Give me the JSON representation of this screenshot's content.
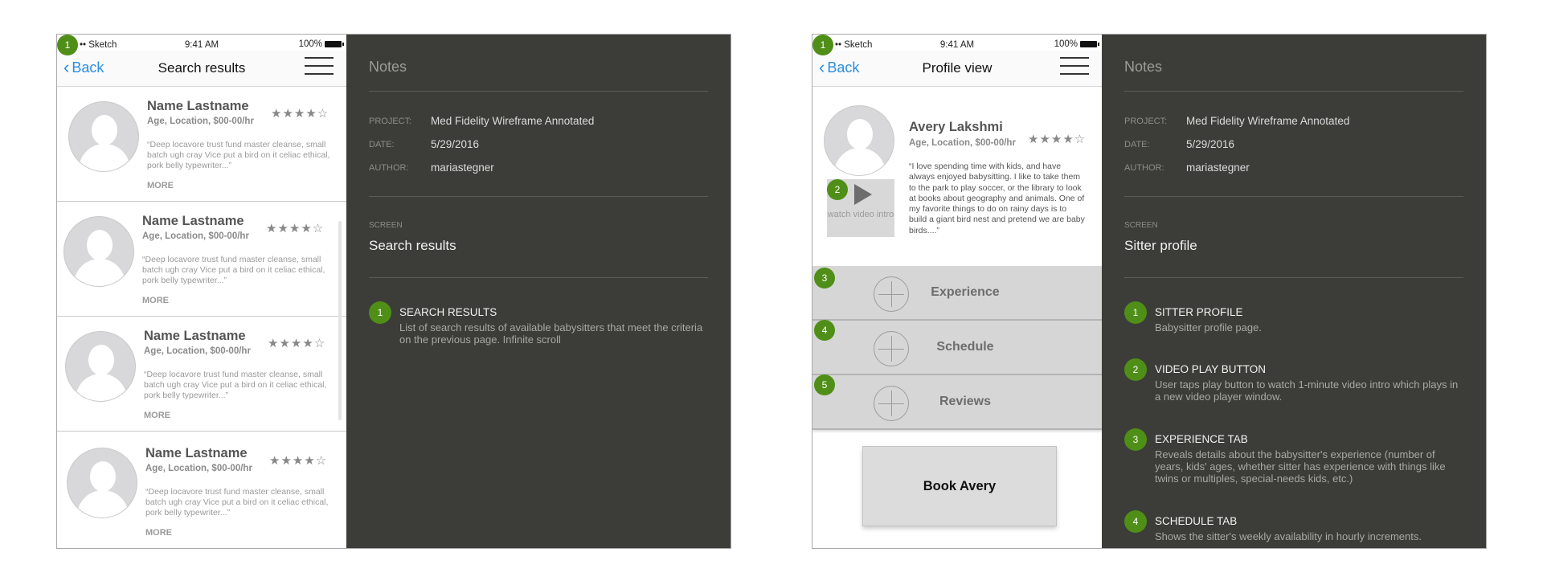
{
  "status_bar": {
    "carrier": "•• Sketch",
    "time": "9:41 AM",
    "battery": "100%"
  },
  "colors": {
    "badge": "#4f8f18",
    "notes_bg": "#3c3d38",
    "link": "#2a8de0"
  },
  "left": {
    "nav": {
      "back": "Back",
      "title": "Search results"
    },
    "badge": "1",
    "results": [
      {
        "name": "Name Lastname",
        "meta": "Age, Location, $00-00/hr",
        "stars": "★★★★☆",
        "quote": "“Deep locavore trust fund master cleanse, small batch ugh cray Vice put a bird on it celiac ethical, pork belly typewriter...”",
        "more": "MORE"
      },
      {
        "name": "Name Lastname",
        "meta": "Age, Location, $00-00/hr",
        "stars": "★★★★☆",
        "quote": "“Deep locavore trust fund master cleanse, small batch ugh cray Vice put a bird on it celiac ethical, pork belly typewriter...”",
        "more": "MORE"
      },
      {
        "name": "Name Lastname",
        "meta": "Age, Location, $00-00/hr",
        "stars": "★★★★☆",
        "quote": "“Deep locavore trust fund master cleanse, small batch ugh cray Vice put a bird on it celiac ethical, pork belly typewriter...”",
        "more": "MORE"
      },
      {
        "name": "Name Lastname",
        "meta": "Age, Location, $00-00/hr",
        "stars": "★★★★☆",
        "quote": "“Deep locavore trust fund master cleanse, small batch ugh cray Vice put a bird on it celiac ethical, pork belly typewriter...”",
        "more": "MORE"
      }
    ],
    "notes": {
      "title": "Notes",
      "project_label": "PROJECT:",
      "project": "Med Fidelity Wireframe Annotated",
      "date_label": "DATE:",
      "date": "5/29/2016",
      "author_label": "AUTHOR:",
      "author": "mariastegner",
      "screen_label": "SCREEN",
      "screen": "Search results",
      "items": [
        {
          "num": "1",
          "head": "SEARCH RESULTS",
          "body": "List of search results of available babysitters that meet the criteria on the previous page. Infinite scroll"
        }
      ]
    }
  },
  "right": {
    "nav": {
      "back": "Back",
      "title": "Profile view"
    },
    "badges": [
      "1",
      "2",
      "3",
      "4",
      "5"
    ],
    "profile": {
      "name": "Avery Lakshmi",
      "meta": "Age, Location, $00-00/hr",
      "stars": "★★★★☆",
      "bio": "“I love spending time with kids, and have always enjoyed babysitting. I like to take them to the park to play soccer, or the library to look at books about geography and animals. One of my favorite things to do on rainy days is to build a giant bird nest and pretend we are baby birds....”",
      "video_label": "watch video intro"
    },
    "tabs": [
      "Experience",
      "Schedule",
      "Reviews"
    ],
    "book_button": "Book Avery",
    "notes": {
      "title": "Notes",
      "project_label": "PROJECT:",
      "project": "Med Fidelity Wireframe Annotated",
      "date_label": "DATE:",
      "date": "5/29/2016",
      "author_label": "AUTHOR:",
      "author": "mariastegner",
      "screen_label": "SCREEN",
      "screen": "Sitter profile",
      "items": [
        {
          "num": "1",
          "head": "SITTER PROFILE",
          "body": "Babysitter profile page."
        },
        {
          "num": "2",
          "head": "VIDEO PLAY BUTTON",
          "body": "User taps play button to watch 1-minute video intro which plays in a new video player window."
        },
        {
          "num": "3",
          "head": "EXPERIENCE TAB",
          "body": "Reveals details about the babysitter's experience (number of years, kids' ages, whether sitter has experience with things like twins or multiples, special-needs kids, etc.)"
        },
        {
          "num": "4",
          "head": "SCHEDULE TAB",
          "body": "Shows the sitter's weekly availability in hourly increments."
        }
      ]
    }
  }
}
